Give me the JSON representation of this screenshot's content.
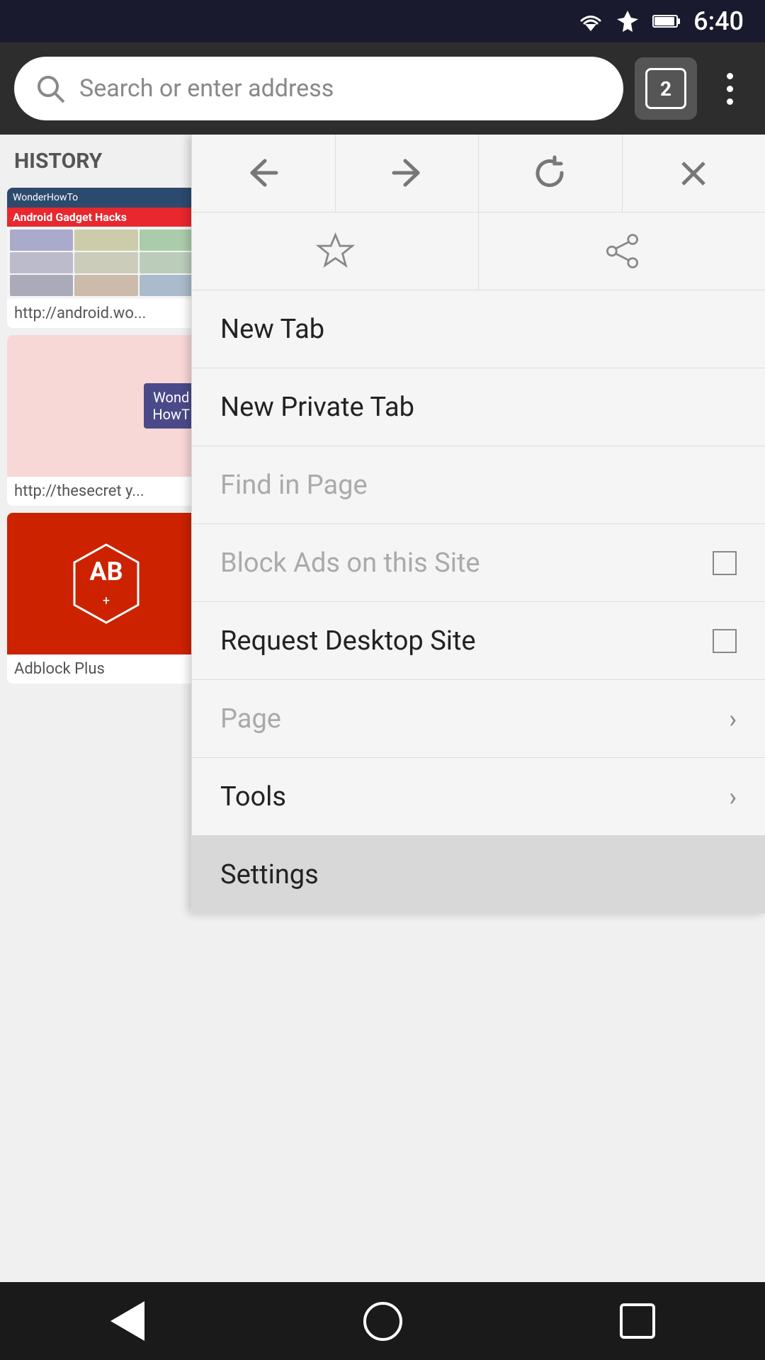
{
  "statusBar": {
    "time": "6:40",
    "wifiIcon": "wifi-icon",
    "airplaneIcon": "airplane-icon",
    "batteryIcon": "battery-icon"
  },
  "toolbar": {
    "searchPlaceholder": "Search or enter address",
    "tabCount": "2",
    "tabsLabel": "2 tabs open",
    "menuLabel": "More options"
  },
  "history": {
    "label": "HISTORY",
    "items": [
      {
        "url": "http://android.wo...",
        "title": "WonderHowTo"
      },
      {
        "url": "http://thesecret y...",
        "title": "Wonder HowTo pink"
      },
      {
        "url": "",
        "title": "Adblock Plus"
      }
    ]
  },
  "historyLabel": "HISTORY",
  "historyItem1Url": "http://android.wo...",
  "historyItem2Url": "http://thesecret y...",
  "historyItem3Label": "Adblock Plus",
  "menu": {
    "backLabel": "←",
    "forwardLabel": "→",
    "reloadLabel": "↻",
    "bookmarkLabel": "☆",
    "shareLabel": "share",
    "items": [
      {
        "id": "new-tab",
        "label": "New Tab",
        "type": "normal",
        "disabled": false
      },
      {
        "id": "new-private-tab",
        "label": "New Private Tab",
        "type": "normal",
        "disabled": false
      },
      {
        "id": "find-in-page",
        "label": "Find in Page",
        "type": "normal",
        "disabled": true
      },
      {
        "id": "block-ads",
        "label": "Block Ads on this Site",
        "type": "checkbox",
        "disabled": true,
        "checked": false
      },
      {
        "id": "request-desktop",
        "label": "Request Desktop Site",
        "type": "checkbox",
        "disabled": false,
        "checked": false
      },
      {
        "id": "page",
        "label": "Page",
        "type": "submenu",
        "disabled": false
      },
      {
        "id": "tools",
        "label": "Tools",
        "type": "submenu",
        "disabled": false
      },
      {
        "id": "settings",
        "label": "Settings",
        "type": "normal",
        "disabled": false,
        "highlighted": true
      }
    ]
  },
  "navBar": {
    "backButton": "back",
    "homeButton": "home",
    "recentButton": "recent"
  }
}
